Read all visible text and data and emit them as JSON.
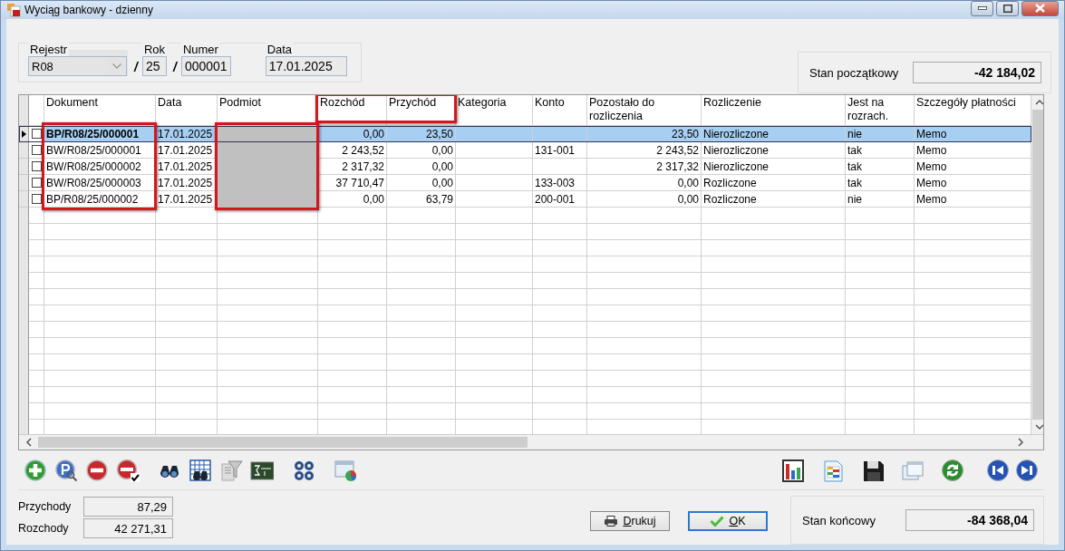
{
  "window": {
    "title": "Wyciąg bankowy - dzienny"
  },
  "header": {
    "fields": [
      {
        "label": "Rejestr",
        "value": "R08",
        "kind": "combo"
      },
      {
        "label": "Rok",
        "value": "25",
        "kind": "text",
        "prefix": "/"
      },
      {
        "label": "Numer",
        "value": "000001",
        "kind": "text",
        "prefix": "/"
      },
      {
        "label": "Data",
        "value": "17.01.2025",
        "kind": "date"
      }
    ]
  },
  "opening_balance": {
    "label": "Stan początkowy",
    "value": "-42 184,02"
  },
  "table": {
    "columns": [
      {
        "label": "Dokument",
        "kind": "text",
        "cells_highlighted": true,
        "header_highlighted": false
      },
      {
        "label": "Data",
        "kind": "text",
        "cells_highlighted": false,
        "header_highlighted": false
      },
      {
        "label": "Podmiot",
        "kind": "redacted",
        "cells_highlighted": true,
        "header_highlighted": false
      },
      {
        "label": "Rozchód",
        "kind": "number",
        "cells_highlighted": false,
        "header_highlighted": true
      },
      {
        "label": "Przychód",
        "kind": "number",
        "cells_highlighted": false,
        "header_highlighted": true
      },
      {
        "label": "Kategoria",
        "kind": "text",
        "cells_highlighted": false,
        "header_highlighted": false
      },
      {
        "label": "Konto",
        "kind": "text",
        "cells_highlighted": false,
        "header_highlighted": false
      },
      {
        "label": "Pozostało do rozliczenia",
        "kind": "number",
        "cells_highlighted": false,
        "header_highlighted": false
      },
      {
        "label": "Rozliczenie",
        "kind": "text",
        "cells_highlighted": false,
        "header_highlighted": false
      },
      {
        "label": "Jest na rozrach.",
        "kind": "text",
        "cells_highlighted": false,
        "header_highlighted": false
      },
      {
        "label": "Szczegóły płatności",
        "kind": "text",
        "cells_highlighted": false,
        "header_highlighted": false
      }
    ],
    "rows": [
      {
        "selected": true,
        "checked": false,
        "cells": [
          "BP/R08/25/000001",
          "17.01.2025",
          null,
          "0,00",
          "23,50",
          null,
          null,
          "23,50",
          "Nierozliczone",
          "nie",
          "Memo"
        ]
      },
      {
        "selected": false,
        "checked": false,
        "cells": [
          "BW/R08/25/000001",
          "17.01.2025",
          null,
          "2 243,52",
          "0,00",
          null,
          "131-001",
          "2 243,52",
          "Nierozliczone",
          "tak",
          "Memo"
        ]
      },
      {
        "selected": false,
        "checked": false,
        "cells": [
          "BW/R08/25/000002",
          "17.01.2025",
          null,
          "2 317,32",
          "0,00",
          null,
          null,
          "2 317,32",
          "Nierozliczone",
          "tak",
          "Memo"
        ]
      },
      {
        "selected": false,
        "checked": false,
        "cells": [
          "BW/R08/25/000003",
          "17.01.2025",
          null,
          "37 710,47",
          "0,00",
          null,
          "133-003",
          "0,00",
          "Rozliczone",
          "tak",
          "Memo"
        ]
      },
      {
        "selected": false,
        "checked": false,
        "cells": [
          "BP/R08/25/000002",
          "17.01.2025",
          null,
          "0,00",
          "63,79",
          null,
          "200-001",
          "0,00",
          "Rozliczone",
          "nie",
          "Memo"
        ]
      }
    ]
  },
  "totals": [
    {
      "label": "Przychody",
      "value": "87,29"
    },
    {
      "label": "Rozchody",
      "value": "42 271,31"
    }
  ],
  "buttons": [
    {
      "label": "Drukuj",
      "kind": "print",
      "default": false
    },
    {
      "label": "OK",
      "kind": "ok",
      "default": true
    }
  ],
  "closing_balance": {
    "label": "Stan końcowy",
    "value": "-84 368,04"
  }
}
